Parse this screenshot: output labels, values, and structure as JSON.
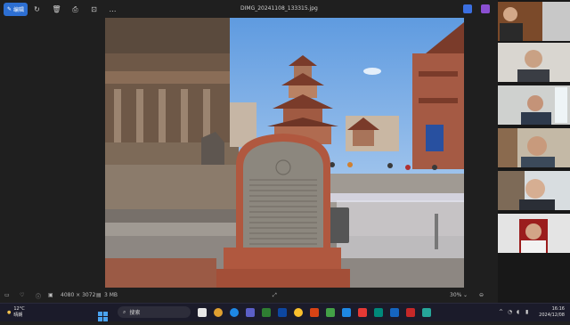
{
  "toolbar": {
    "edit_label": "编辑"
  },
  "file": {
    "title": "DIMG_20241108_133315.jpg"
  },
  "status": {
    "dimensions": "4080 × 3072",
    "size": "3 MB",
    "zoom": "30%"
  },
  "taskbar": {
    "search_placeholder": "搜索",
    "weather_temp": "12°C",
    "weather_desc": "晴朗",
    "time": "16:16",
    "date": "2024/12/08"
  },
  "stone": {
    "inscription_lines": 14
  },
  "colors": {
    "accent": "#2d6fd2",
    "brick": "#b0583f",
    "sky": "#87b6e8"
  }
}
